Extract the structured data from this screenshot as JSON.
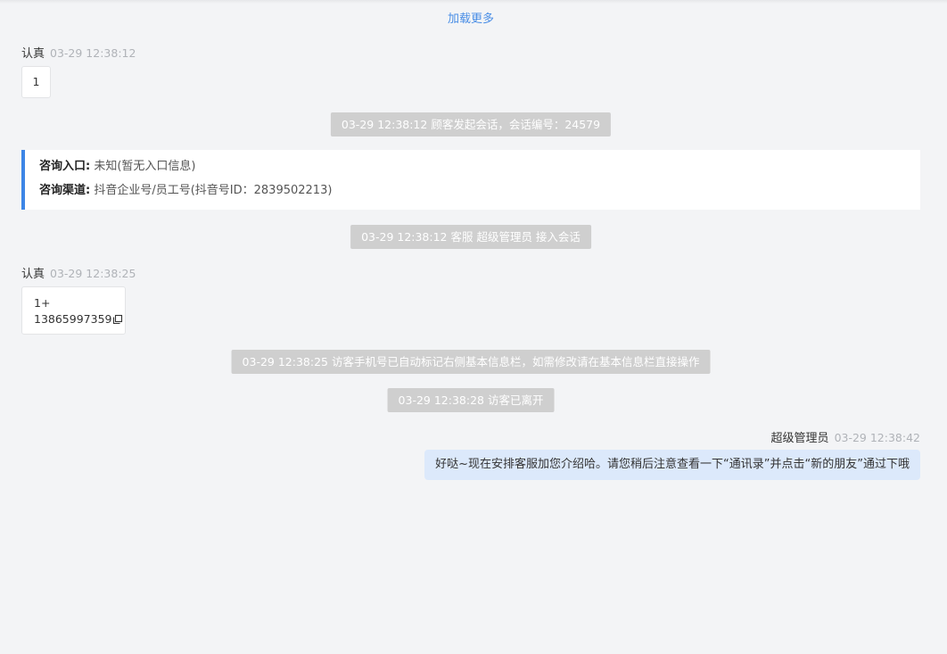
{
  "load_more": "加载更多",
  "messages": {
    "m1": {
      "name": "认真",
      "time": "03-29 12:38:12",
      "text": "1"
    },
    "m2": {
      "name": "认真",
      "time": "03-29 12:38:25",
      "line1": "1+",
      "line2": "13865997359"
    },
    "reply": {
      "name": "超级管理员",
      "time": "03-29 12:38:42",
      "text": "好哒~现在安排客服加您介绍哈。请您稍后注意查看一下“通讯录”并点击“新的朋友”通过下哦"
    }
  },
  "system": {
    "s1": "03-29 12:38:12 顾客发起会话，会话编号：24579",
    "s2": "03-29 12:38:12 客服 超级管理员 接入会话",
    "s3": "03-29 12:38:25 访客手机号已自动标记右侧基本信息栏，如需修改请在基本信息栏直接操作",
    "s4": "03-29 12:38:28 访客已离开"
  },
  "info_card": {
    "entry_label": "咨询入口:",
    "entry_value": "未知(暂无入口信息)",
    "channel_label": "咨询渠道:",
    "channel_value": "抖音企业号/员工号(抖音号ID：2839502213)"
  },
  "colors": {
    "background": "#f3f4f6",
    "accent": "#3d86e6",
    "system_bubble": "#cfcfcf",
    "reply_bubble": "#dce9fb"
  },
  "icons": {
    "copy": "copy-icon"
  }
}
